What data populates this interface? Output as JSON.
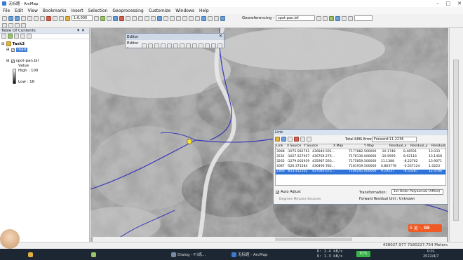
{
  "window": {
    "title": "无标题 - ArcMap"
  },
  "menu": [
    "File",
    "Edit",
    "View",
    "Bookmarks",
    "Insert",
    "Selection",
    "Geoprocessing",
    "Customize",
    "Windows",
    "Help"
  ],
  "toolbar": {
    "scale": "1:6,000",
    "georeferencing_label": "Georeferencing -",
    "georef_layer": "spot-pan.bil"
  },
  "toc": {
    "title": "Table Of Contents",
    "dataframe": "Task3",
    "layer_road": "road",
    "layer_raster": "spot-pan.bil",
    "value_label": "Value",
    "high": "High : 100",
    "low": "Low : 16"
  },
  "editor": {
    "title": "Editor",
    "menu_label": "Editor -"
  },
  "link": {
    "title": "Link",
    "rms_label": "Total RMS Error:",
    "rms_value": "Forward:11.2236",
    "headers": [
      "Link",
      "X Source",
      "Y Source",
      "X Map",
      "Y Map",
      "Residual_x",
      "Residual_y",
      "Residual"
    ],
    "rows": [
      [
        "1",
        "3988",
        "-1075.082761",
        "436840.591...",
        "7177882.500000",
        "-10.1748",
        "8.48591",
        "13.033"
      ],
      [
        "2",
        "3531",
        "-1027.527957",
        "436769.275...",
        "7178130.000000",
        "-10.9599",
        "8.92116",
        "13.1458"
      ],
      [
        "3",
        "3265",
        "-1279.002939",
        "435987.593...",
        "7175859.500000",
        "11.1388",
        "-8.22762",
        "13.9071"
      ],
      [
        "4",
        "3087",
        "-526.371584",
        "436490.782...",
        "7181919.500000",
        "0.803778",
        "-0.547124",
        "1.0223"
      ],
      [
        "5",
        "2366",
        "-813.412502",
        "437083.675...",
        "7180241.000000",
        "9.19237",
        "-8.53287",
        "12.4788"
      ]
    ],
    "auto_adjust": "Auto Adjust",
    "dms": "Degrees Minutes Seconds",
    "transformation_label": "Transformation:",
    "transformation_value": "1st Order Polynomial (Affine)",
    "forward_unit": "Forward Residual Unit : Unknown"
  },
  "status": {
    "coords": "438027.977  7180227.754 Meters"
  },
  "ime": {
    "label": "英"
  },
  "taskbar": {
    "items": [
      "Dialog - F:\\练...",
      "无标题 - ArcMap"
    ],
    "net_up": "D:  2.4 kB/s",
    "net_down": "U:  1.3 kB/s",
    "battery": "91%",
    "time": "0:01",
    "date": "2022/4/7"
  }
}
